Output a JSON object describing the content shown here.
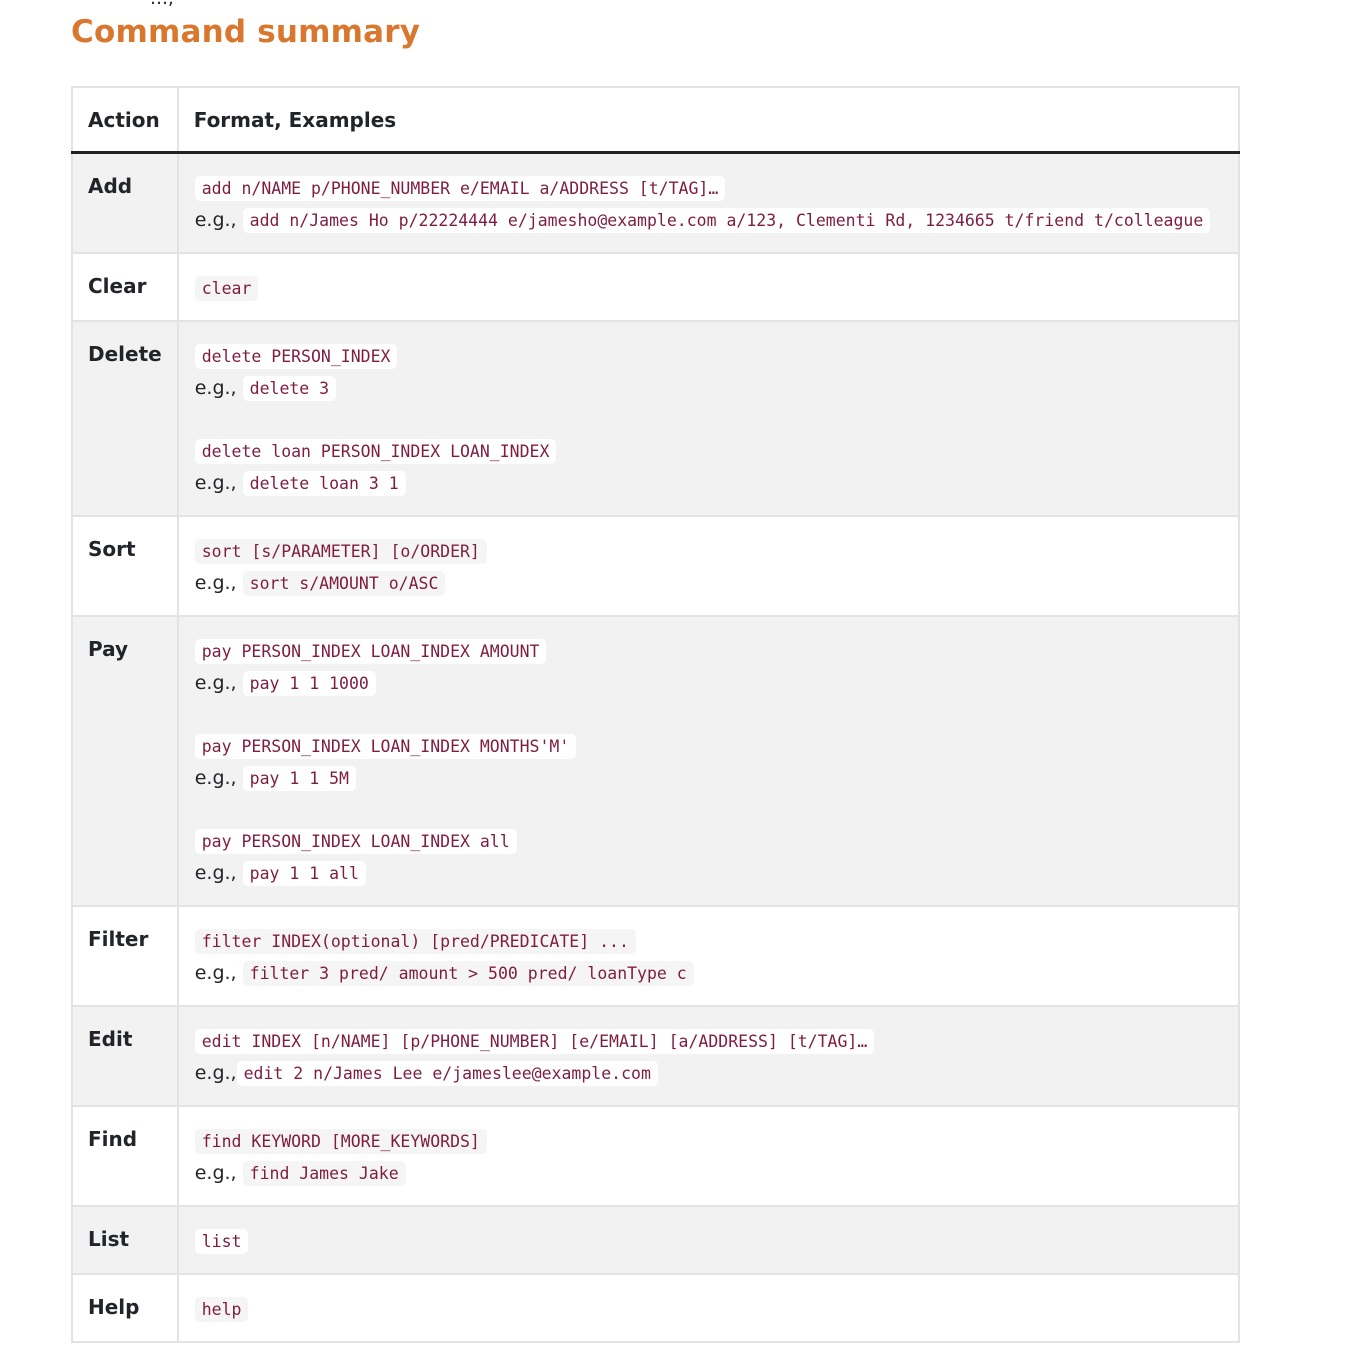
{
  "top_fragment": "…,",
  "title": "Command summary",
  "table": {
    "headers": [
      "Action",
      "Format, Examples"
    ],
    "eg_label": "e.g.,",
    "rows": [
      {
        "action": "Add",
        "blocks": [
          {
            "format": "add n/NAME p/PHONE_NUMBER e/EMAIL a/ADDRESS [t/TAG]…",
            "example": "add n/James Ho p/22224444 e/jamesho@example.com a/123, Clementi Rd, 1234665 t/friend t/colleague"
          }
        ]
      },
      {
        "action": "Clear",
        "blocks": [
          {
            "format": "clear"
          }
        ]
      },
      {
        "action": "Delete",
        "blocks": [
          {
            "format": "delete PERSON_INDEX",
            "example": "delete 3"
          },
          {
            "format": "delete loan PERSON_INDEX LOAN_INDEX",
            "example": "delete loan 3 1"
          }
        ]
      },
      {
        "action": "Sort",
        "blocks": [
          {
            "format": "sort [s/PARAMETER] [o/ORDER]",
            "example": "sort s/AMOUNT o/ASC"
          }
        ]
      },
      {
        "action": "Pay",
        "blocks": [
          {
            "format": "pay PERSON_INDEX LOAN_INDEX AMOUNT",
            "example": "pay 1 1 1000"
          },
          {
            "format": "pay PERSON_INDEX LOAN_INDEX MONTHS'M'",
            "example": "pay 1 1 5M"
          },
          {
            "format": "pay PERSON_INDEX LOAN_INDEX all",
            "example": "pay 1 1 all"
          }
        ]
      },
      {
        "action": "Filter",
        "blocks": [
          {
            "format": "filter INDEX(optional) [pred/PREDICATE] ...",
            "example": "filter 3 pred/ amount > 500 pred/ loanType c"
          }
        ]
      },
      {
        "action": "Edit",
        "blocks": [
          {
            "format": "edit INDEX [n/NAME] [p/PHONE_NUMBER] [e/EMAIL] [a/ADDRESS] [t/TAG]…",
            "example": "edit 2 n/James Lee e/jameslee@example.com"
          }
        ]
      },
      {
        "action": "Find",
        "blocks": [
          {
            "format": "find KEYWORD [MORE_KEYWORDS]",
            "example": "find James Jake"
          }
        ]
      },
      {
        "action": "List",
        "blocks": [
          {
            "format": "list"
          }
        ]
      },
      {
        "action": "Help",
        "blocks": [
          {
            "format": "help"
          }
        ]
      }
    ]
  }
}
